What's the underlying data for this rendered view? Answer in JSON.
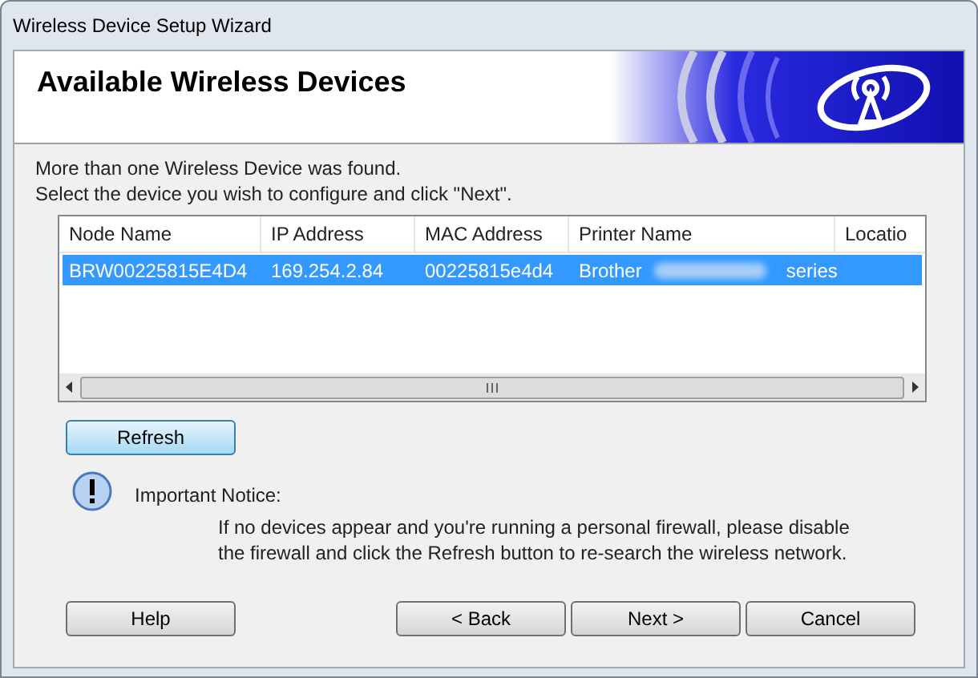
{
  "window": {
    "title": "Wireless Device Setup Wizard"
  },
  "header": {
    "title": "Available Wireless Devices"
  },
  "instructions": [
    "More than one Wireless Device was found.",
    "Select the device you wish to configure and click \"Next\"."
  ],
  "device_list": {
    "columns": [
      "Node Name",
      "IP Address",
      "MAC Address",
      "Printer Name",
      "Locatio"
    ],
    "rows": [
      {
        "selected": true,
        "node_name": "BRW00225815E4D4",
        "ip_address": "169.254.2.84",
        "mac_address": "00225815e4d4",
        "printer_name": {
          "before_redaction": "Brother",
          "after_redaction": "series"
        }
      }
    ]
  },
  "refresh_button": {
    "label": "Refresh"
  },
  "notice": {
    "title": "Important Notice:",
    "text": "If no devices appear and you're running a personal firewall, please disable the firewall and click the Refresh button to re-search the wireless network."
  },
  "buttons": [
    {
      "label": "Help",
      "kind": "left"
    },
    {
      "label": "< Back",
      "kind": "right"
    },
    {
      "label": "Next >",
      "kind": "right"
    },
    {
      "label": "Cancel",
      "kind": "right"
    }
  ]
}
